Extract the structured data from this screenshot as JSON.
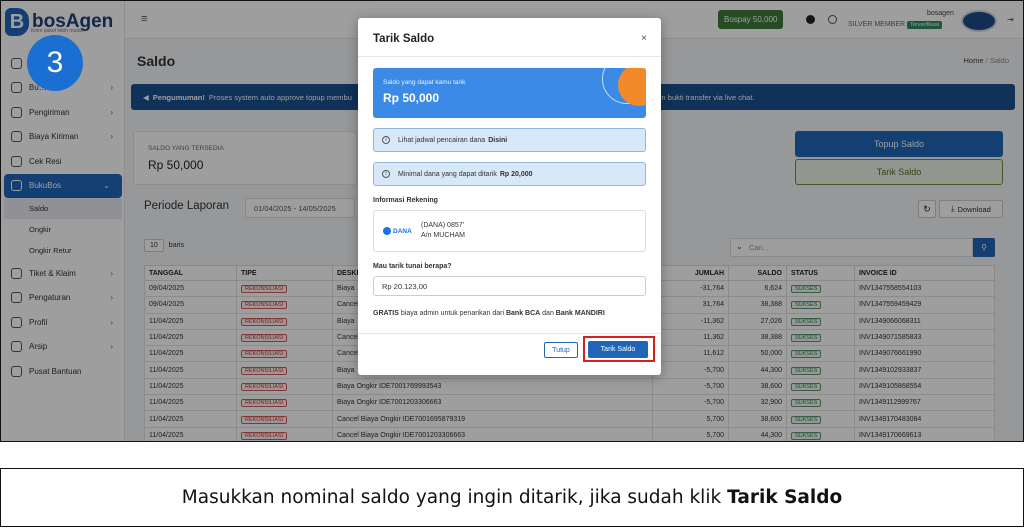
{
  "step_number": "3",
  "brand": {
    "name": "bosAgen",
    "tagline": "Kirim paket lebih mudah"
  },
  "sidebar": {
    "items": [
      {
        "label": "Bu…"
      },
      {
        "label": "Pengiriman"
      },
      {
        "label": "Biaya Kiriman"
      },
      {
        "label": "Cek Resi"
      },
      {
        "label": "BukuBos"
      },
      {
        "label": "Tiket & Klaim"
      },
      {
        "label": "Pengaturan"
      },
      {
        "label": "Profil"
      },
      {
        "label": "Arsip"
      },
      {
        "label": "Pusat Bantuan"
      }
    ],
    "subitems": [
      "Saldo",
      "Ongkir",
      "Ongkir Retur"
    ]
  },
  "topbar": {
    "bospay": "Bospay  50,000",
    "member": "SILVER MEMBER",
    "verified": "Terverifikasi",
    "username": "bosagen"
  },
  "page": {
    "title": "Saldo",
    "breadcrumb_home": "Home",
    "breadcrumb_sep": "/",
    "breadcrumb_current": "Saldo"
  },
  "announcement": {
    "label": "Pengumuman!",
    "text": "Proses system auto approve topup membu",
    "text_tail": "in bukti transfer via live chat."
  },
  "saldo": {
    "label": "SALDO YANG TERSEDIA",
    "value": "Rp 50,000"
  },
  "actions": {
    "topup": "Topup Saldo",
    "tarik": "Tarik Saldo",
    "download": "Download"
  },
  "report": {
    "label": "Periode Laporan",
    "date_range": "01/04/2025 - 14/05/2025"
  },
  "table_controls": {
    "per_page": "10",
    "per_page_label": "baris",
    "search_placeholder": "Cari..."
  },
  "table": {
    "headers": [
      "TANGGAL",
      "TIPE",
      "DESKR",
      "JUMLAH",
      "SALDO",
      "STATUS",
      "INVOICE ID"
    ],
    "rows": [
      {
        "date": "09/04/2025",
        "type": "REKONSILIASI",
        "desc": "Biaya",
        "amount": "-31,764",
        "saldo": "6,624",
        "status": "SUKSES",
        "invoice": "INV1347558554103"
      },
      {
        "date": "09/04/2025",
        "type": "REKONSILIASI",
        "desc": "Cancel",
        "amount": "31,764",
        "saldo": "38,388",
        "status": "SUKSES",
        "invoice": "INV1347559459429"
      },
      {
        "date": "11/04/2025",
        "type": "REKONSILIASI",
        "desc": "Biaya",
        "amount": "-11,362",
        "saldo": "27,026",
        "status": "SUKSES",
        "invoice": "INV1349066068311"
      },
      {
        "date": "11/04/2025",
        "type": "REKONSILIASI",
        "desc": "Cancel",
        "amount": "11,362",
        "saldo": "38,388",
        "status": "SUKSES",
        "invoice": "INV1349071585833"
      },
      {
        "date": "11/04/2025",
        "type": "REKONSILIASI",
        "desc": "Cancel",
        "amount": "11,612",
        "saldo": "50,000",
        "status": "SUKSES",
        "invoice": "INV1349076661990"
      },
      {
        "date": "11/04/2025",
        "type": "REKONSILIASI",
        "desc": "Biaya",
        "amount": "-5,700",
        "saldo": "44,300",
        "status": "SUKSES",
        "invoice": "INV1349102933837"
      },
      {
        "date": "11/04/2025",
        "type": "REKONSILIASI",
        "desc": "Biaya Ongkir IDE7001769993543",
        "amount": "-5,700",
        "saldo": "38,600",
        "status": "SUKSES",
        "invoice": "INV1349105868554"
      },
      {
        "date": "11/04/2025",
        "type": "REKONSILIASI",
        "desc": "Biaya Ongkir IDE7001203306663",
        "amount": "-5,700",
        "saldo": "32,900",
        "status": "SUKSES",
        "invoice": "INV1349112999767"
      },
      {
        "date": "11/04/2025",
        "type": "REKONSILIASI",
        "desc": "Cancel Biaya Ongkir IDE7001695879319",
        "amount": "5,700",
        "saldo": "38,600",
        "status": "SUKSES",
        "invoice": "INV1349170483084"
      },
      {
        "date": "11/04/2025",
        "type": "REKONSILIASI",
        "desc": "Cancel Biaya Ongkir IDE7001203306663",
        "amount": "5,700",
        "saldo": "44,300",
        "status": "SUKSES",
        "invoice": "INV1349170669613"
      }
    ]
  },
  "modal": {
    "title": "Tarik Saldo",
    "close": "×",
    "card_label": "Saldo yang dapat kamu tarik",
    "card_value": "Rp 50,000",
    "info1": "Lihat jadwal pencairan dana",
    "info1_link": "Disini",
    "info2": "Minimal dana yang dapat ditarik",
    "info2_value": "Rp 20,000",
    "rekening_label": "Informasi Rekening",
    "dana_logo": "DANA",
    "rek_line1": "(DANA) 0857'",
    "rek_line2": "A/n MUCHAM",
    "amount_label": "Mau tarik tunai berapa?",
    "amount_value": "Rp 20.123,00",
    "gratis_1": "GRATIS",
    "gratis_2": "biaya admin untuk penarikan dari",
    "gratis_bank1": "Bank BCA",
    "gratis_and": "dan",
    "gratis_bank2": "Bank MANDIRI",
    "tutup": "Tutup",
    "submit": "Tarik Saldo"
  },
  "caption": {
    "text": "Masukkan nominal saldo yang ingin ditarik, jika sudah klik",
    "bold": "Tarik Saldo"
  },
  "colors": {
    "primary": "#1f66b8",
    "highlight": "#d81f1f",
    "accent_orange": "#f28a2a",
    "success": "#2f7a43",
    "danger": "#c0392b"
  }
}
